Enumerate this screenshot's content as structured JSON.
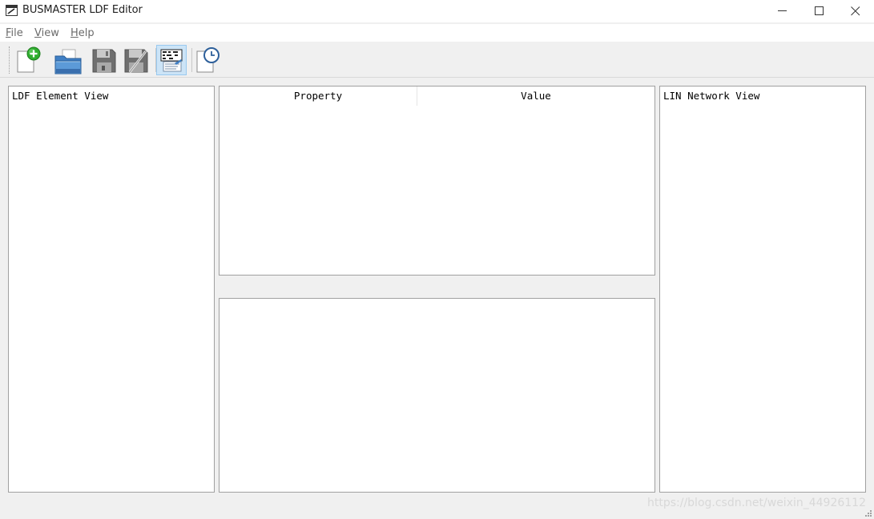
{
  "window": {
    "title": "BUSMASTER LDF Editor",
    "controls": {
      "minimize": "minimize-icon",
      "maximize": "maximize-icon",
      "close": "close-icon"
    }
  },
  "menubar": {
    "items": [
      {
        "label": "File",
        "mnemonic": "F",
        "rest": "ile"
      },
      {
        "label": "View",
        "mnemonic": "V",
        "rest": "iew"
      },
      {
        "label": "Help",
        "mnemonic": "H",
        "rest": "elp"
      }
    ]
  },
  "toolbar": {
    "buttons": [
      {
        "name": "new-file",
        "icon": "new-document-icon",
        "has_dropdown": true
      },
      {
        "name": "open-file",
        "icon": "open-folder-icon"
      },
      {
        "name": "save",
        "icon": "save-icon",
        "disabled": true
      },
      {
        "name": "save-as",
        "icon": "save-as-icon",
        "disabled": true
      },
      {
        "name": "preview",
        "icon": "ldf-preview-icon",
        "active": true
      },
      {
        "name": "schedule",
        "icon": "clock-document-icon",
        "has_dropdown": true
      }
    ]
  },
  "panels": {
    "left": {
      "title": "LDF Element View"
    },
    "property": {
      "columns": [
        "Property",
        "Value"
      ]
    },
    "bottom": {},
    "right": {
      "title": "LIN Network View"
    }
  },
  "watermark": "https://blog.csdn.net/weixin_44926112",
  "colors": {
    "window_bg": "#f0f0f0",
    "panel_bg": "#ffffff",
    "panel_border": "#a0a0a0",
    "active_button_bg": "#cce4f7",
    "active_button_border": "#99c9ef"
  }
}
